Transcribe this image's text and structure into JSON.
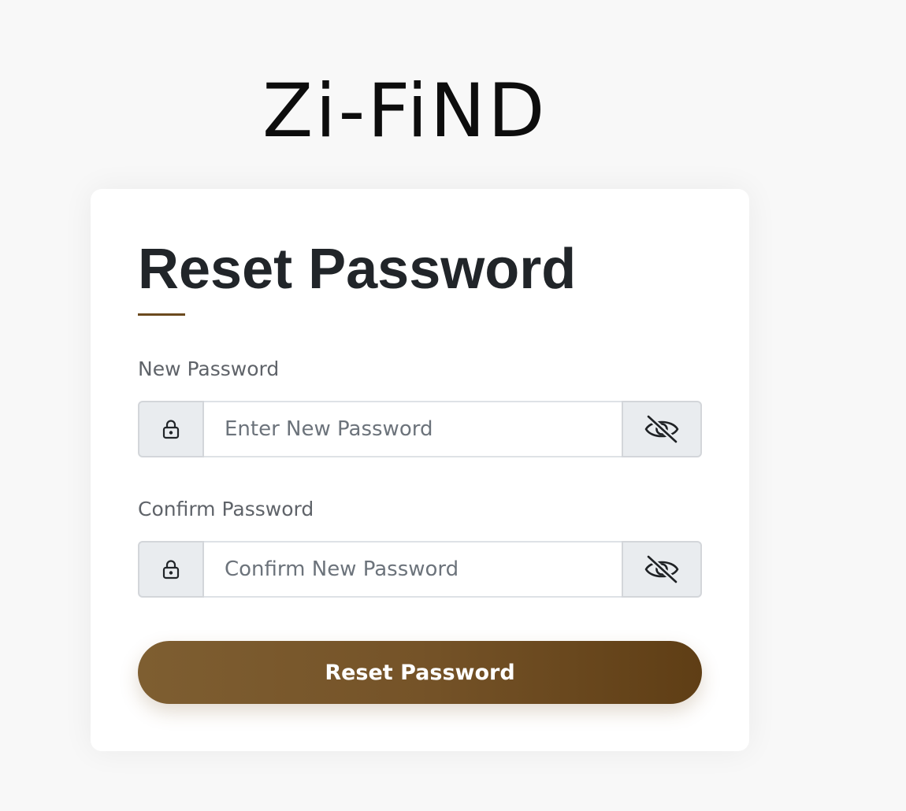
{
  "brand": {
    "logo_text": "Zi-FiND"
  },
  "form": {
    "title": "Reset Password",
    "new_password": {
      "label": "New Password",
      "placeholder": "Enter New Password",
      "value": "",
      "lock_icon": "lock-icon",
      "toggle_icon": "eye-slash-icon"
    },
    "confirm_password": {
      "label": "Confirm Password",
      "placeholder": "Confirm New Password",
      "value": "",
      "lock_icon": "lock-icon",
      "toggle_icon": "eye-slash-icon"
    },
    "submit_label": "Reset Password"
  },
  "colors": {
    "page_background": "#f8f8f8",
    "card_background": "#ffffff",
    "accent_brown": "#6b4a1e",
    "button_gradient_start": "#7e5e31",
    "button_gradient_end": "#5f3e15",
    "addon_background": "#e9ecef",
    "title_text": "#212529",
    "label_text": "#5f6369"
  }
}
